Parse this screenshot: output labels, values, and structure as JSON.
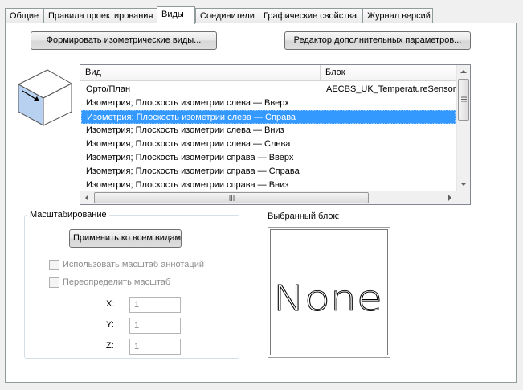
{
  "tabs": [
    {
      "label": "Общие"
    },
    {
      "label": "Правила проектирования"
    },
    {
      "label": "Виды"
    },
    {
      "label": "Соединители"
    },
    {
      "label": "Графические свойства"
    },
    {
      "label": "Журнал версий"
    }
  ],
  "buttons": {
    "generate_iso": "Формировать изометрические виды...",
    "extra_params_editor": "Редактор дополнительных параметров...",
    "apply_all": "Применить ко всем видам"
  },
  "views_list": {
    "columns": [
      "Вид",
      "Блок"
    ],
    "rows": [
      {
        "view": "Орто/План",
        "block": "AECBS_UK_TemperatureSensor",
        "selected": false
      },
      {
        "view": "Изометрия; Плоскость изометрии слева — Вверх",
        "block": "",
        "selected": false
      },
      {
        "view": "Изометрия; Плоскость изометрии слева — Справа",
        "block": "",
        "selected": true
      },
      {
        "view": "Изометрия; Плоскость изометрии слева — Вниз",
        "block": "",
        "selected": false
      },
      {
        "view": "Изометрия; Плоскость изометрии слева — Слева",
        "block": "",
        "selected": false
      },
      {
        "view": "Изометрия; Плоскость изометрии справа — Вверх",
        "block": "",
        "selected": false
      },
      {
        "view": "Изометрия; Плоскость изометрии справа — Справа",
        "block": "",
        "selected": false
      },
      {
        "view": "Изометрия; Плоскость изометрии справа — Вниз",
        "block": "",
        "selected": false
      }
    ]
  },
  "scaling": {
    "title": "Масштабирование",
    "use_annotation_scale": "Использовать масштаб аннотаций",
    "override_scale": "Переопределить масштаб",
    "x_label": "X:",
    "x_value": "1",
    "y_label": "Y:",
    "y_value": "1",
    "z_label": "Z:",
    "z_value": "1"
  },
  "selected_block": {
    "label": "Выбранный блок:",
    "preview_text": "None"
  },
  "colors": {
    "selection": "#3399ff",
    "cube_face": "#b8d1f0"
  }
}
